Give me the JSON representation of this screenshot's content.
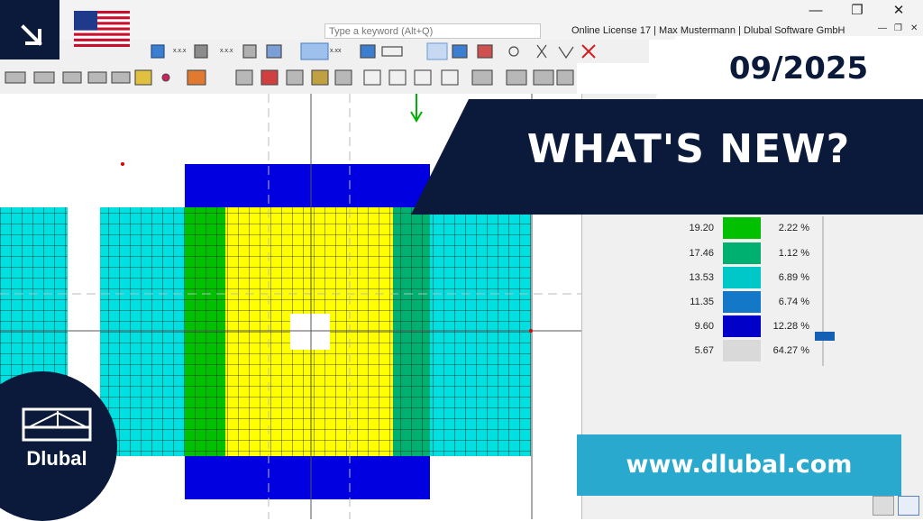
{
  "window": {
    "search_placeholder": "Type a keyword (Alt+Q)",
    "license_text": "Online License 17 | Max Mustermann | Dlubal Software GmbH",
    "minimize": "—",
    "maximize": "❐",
    "close": "✕",
    "small_minimize": "—",
    "small_restore": "❐",
    "small_close": "✕"
  },
  "promo": {
    "date": "09/2025",
    "headline": "WHAT'S NEW?",
    "url": "www.dlubal.com",
    "logo_text": "Dlubal",
    "corner_icon": "arrow-down-right-icon",
    "flag": "us-flag"
  },
  "legend": {
    "rows": [
      {
        "value": "19.20",
        "percent": "2.22 %",
        "color": "#00c000"
      },
      {
        "value": "17.46",
        "percent": "1.12 %",
        "color": "#00b070"
      },
      {
        "value": "13.53",
        "percent": "6.89 %",
        "color": "#00c8c8"
      },
      {
        "value": "11.35",
        "percent": "6.74 %",
        "color": "#1478c8"
      },
      {
        "value": "9.60",
        "percent": "12.28 %",
        "color": "#0000c8"
      },
      {
        "value": "5.67",
        "percent": "64.27 %",
        "color": "#d9d9d9"
      }
    ]
  },
  "colors": {
    "navy": "#0b1a3a",
    "cyan": "#2aa9ce",
    "mesh_yellow": "#ffff00",
    "mesh_green": "#00c000",
    "mesh_teal": "#00b070",
    "mesh_cyan": "#00e0e0",
    "mesh_blue": "#0000e0"
  }
}
